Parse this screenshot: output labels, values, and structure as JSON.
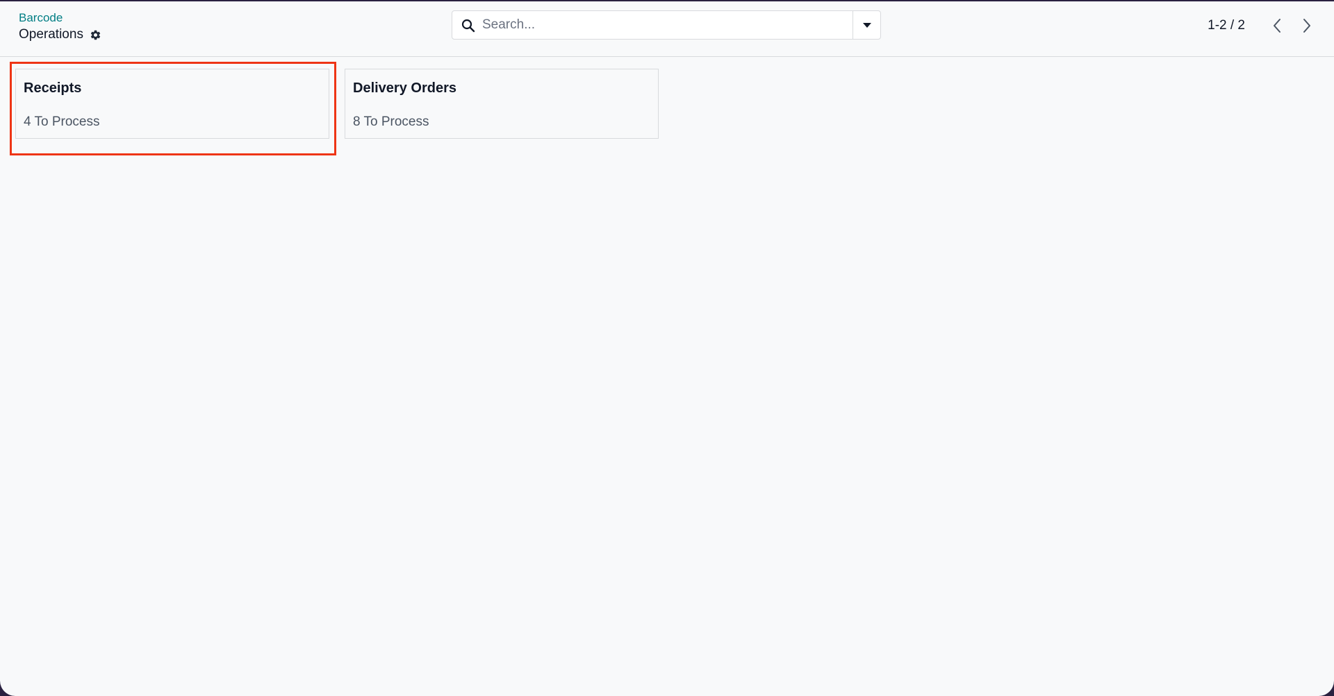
{
  "breadcrumb": {
    "parent": "Barcode",
    "current": "Operations"
  },
  "icons": {
    "settings": "gear-icon",
    "search": "search-icon",
    "toggle": "caret-down-icon",
    "prev": "chevron-left-icon",
    "next": "chevron-right-icon"
  },
  "search": {
    "placeholder": "Search...",
    "value": ""
  },
  "pager": {
    "value": "1-2 / 2"
  },
  "cards": [
    {
      "title": "Receipts",
      "count": "4 To Process"
    },
    {
      "title": "Delivery Orders",
      "count": "8 To Process"
    }
  ],
  "colors": {
    "accent": "#017e84",
    "highlight": "#ee3515",
    "background": "#f8f9fa"
  }
}
